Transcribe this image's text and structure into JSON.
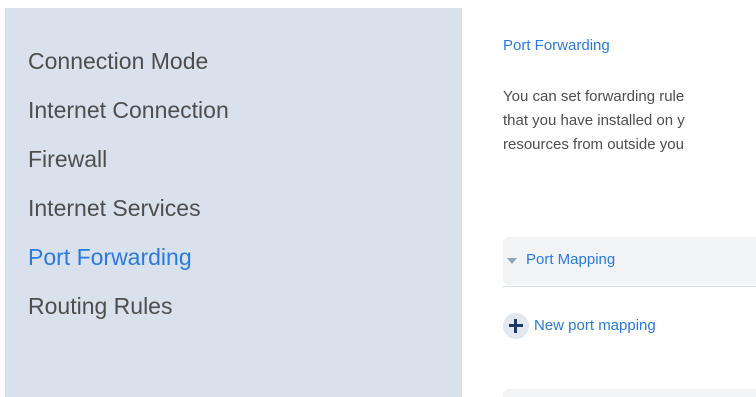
{
  "sidebar": {
    "items": [
      {
        "label": "Connection Mode",
        "active": false
      },
      {
        "label": "Internet Connection",
        "active": false
      },
      {
        "label": "Firewall",
        "active": false
      },
      {
        "label": "Internet Services",
        "active": false
      },
      {
        "label": "Port Forwarding",
        "active": true
      },
      {
        "label": "Routing Rules",
        "active": false
      }
    ]
  },
  "main": {
    "section_title": "Port Forwarding",
    "description_lines": [
      "You can set forwarding rule",
      "that you have installed on y",
      "resources from outside you"
    ],
    "panel": {
      "label": "Port Mapping",
      "caret_icon": "caret-down-icon"
    },
    "new_mapping": {
      "label": "New port mapping",
      "icon": "plus-circle-icon"
    }
  },
  "colors": {
    "accent": "#2a7ae2",
    "sidebar_bg": "#d8e1ec",
    "text": "#4e4e4e"
  }
}
